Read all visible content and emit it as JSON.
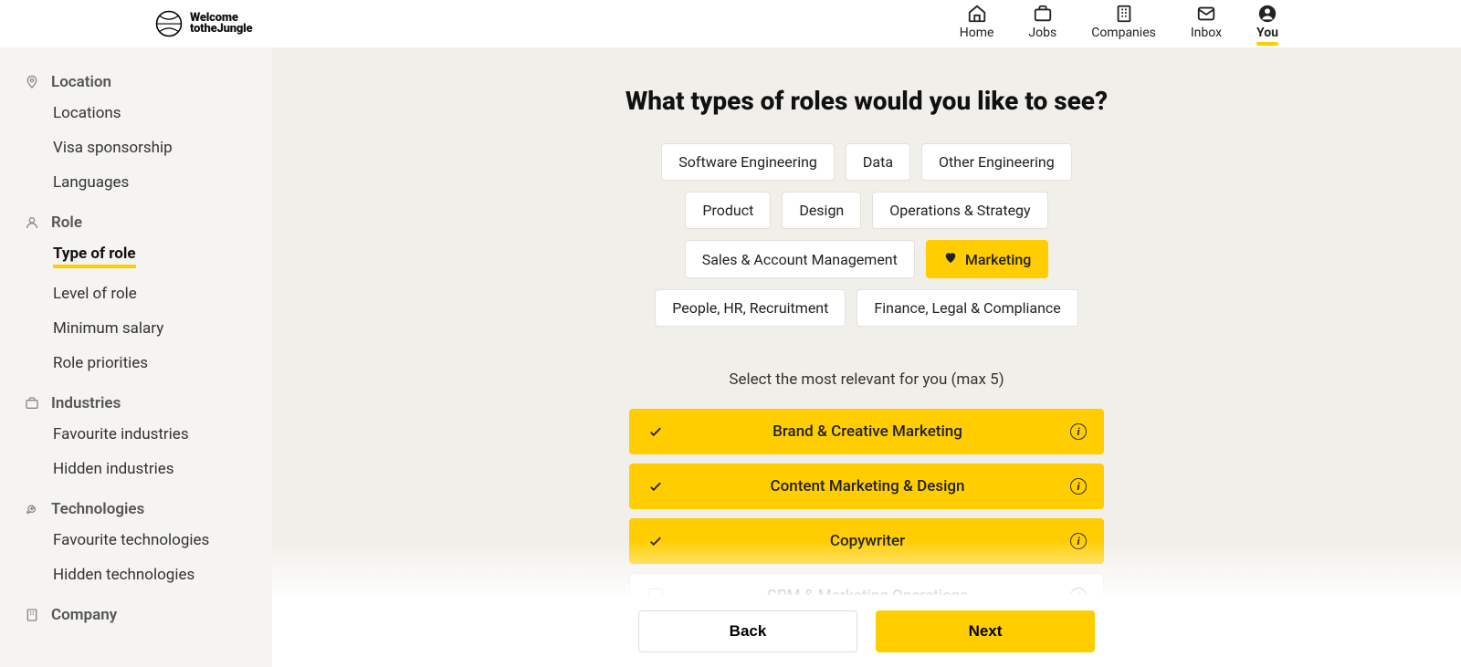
{
  "brand": {
    "line1": "Welcome",
    "line2": "totheJungle"
  },
  "nav": [
    {
      "label": "Home",
      "active": false
    },
    {
      "label": "Jobs",
      "active": false
    },
    {
      "label": "Companies",
      "active": false
    },
    {
      "label": "Inbox",
      "active": false
    },
    {
      "label": "You",
      "active": true
    }
  ],
  "sidebar": {
    "sections": [
      {
        "title": "Location",
        "items": [
          {
            "label": "Locations",
            "active": false
          },
          {
            "label": "Visa sponsorship",
            "active": false
          },
          {
            "label": "Languages",
            "active": false
          }
        ]
      },
      {
        "title": "Role",
        "items": [
          {
            "label": "Type of role",
            "active": true
          },
          {
            "label": "Level of role",
            "active": false
          },
          {
            "label": "Minimum salary",
            "active": false
          },
          {
            "label": "Role priorities",
            "active": false
          }
        ]
      },
      {
        "title": "Industries",
        "items": [
          {
            "label": "Favourite industries",
            "active": false
          },
          {
            "label": "Hidden industries",
            "active": false
          }
        ]
      },
      {
        "title": "Technologies",
        "items": [
          {
            "label": "Favourite technologies",
            "active": false
          },
          {
            "label": "Hidden technologies",
            "active": false
          }
        ]
      },
      {
        "title": "Company",
        "items": []
      }
    ]
  },
  "main": {
    "heading": "What types of roles would you like to see?",
    "chips": [
      {
        "label": "Software Engineering",
        "selected": false
      },
      {
        "label": "Data",
        "selected": false
      },
      {
        "label": "Other Engineering",
        "selected": false
      },
      {
        "label": "Product",
        "selected": false
      },
      {
        "label": "Design",
        "selected": false
      },
      {
        "label": "Operations & Strategy",
        "selected": false
      },
      {
        "label": "Sales & Account Management",
        "selected": false
      },
      {
        "label": "Marketing",
        "selected": true
      },
      {
        "label": "People, HR, Recruitment",
        "selected": false
      },
      {
        "label": "Finance, Legal & Compliance",
        "selected": false
      }
    ],
    "subInstruction": "Select the most relevant for you (max 5)",
    "options": [
      {
        "label": "Brand & Creative Marketing",
        "selected": true
      },
      {
        "label": "Content Marketing & Design",
        "selected": true
      },
      {
        "label": "Copywriter",
        "selected": true
      },
      {
        "label": "CRM & Marketing Operations",
        "selected": false
      }
    ]
  },
  "footer": {
    "back": "Back",
    "next": "Next"
  }
}
